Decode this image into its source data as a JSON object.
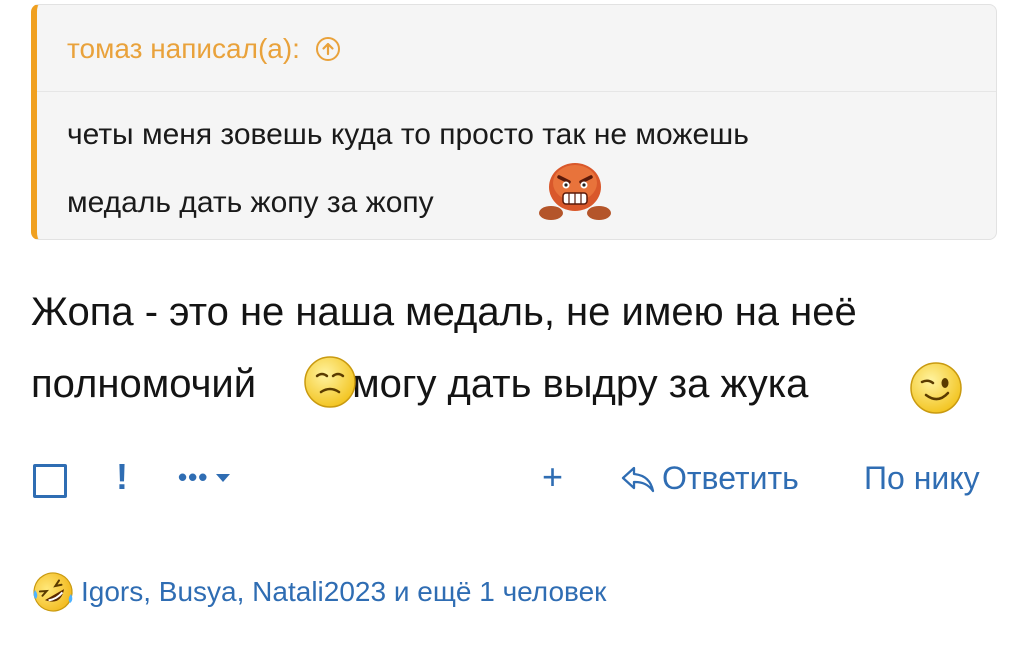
{
  "quote": {
    "author": "томаз написал(а):",
    "line1": "четы меня зовешь куда то просто так не можешь",
    "line2": "медаль дать жопу за жопу",
    "emoji_icon": "angry-face-emoji"
  },
  "post": {
    "line1": "Жопа - это не наша медаль, не имею на неё",
    "line2_before": "полномочий",
    "line2_after": "могу дать выдру за жука",
    "emoji1_icon": "frowning-face-emoji",
    "emoji2_icon": "winking-face-emoji"
  },
  "actions": {
    "report": "!",
    "more": "•••",
    "plus": "+",
    "reply": "Ответить",
    "by_nick": "По нику"
  },
  "reactions": {
    "emoji_icon": "rolling-laughing-emoji",
    "text": "Igors, Busya, Natali2023 и ещё 1 человек"
  },
  "colors": {
    "accent": "#2f6db3",
    "quote_bar": "#f0a020",
    "quote_author": "#e9a23b"
  }
}
